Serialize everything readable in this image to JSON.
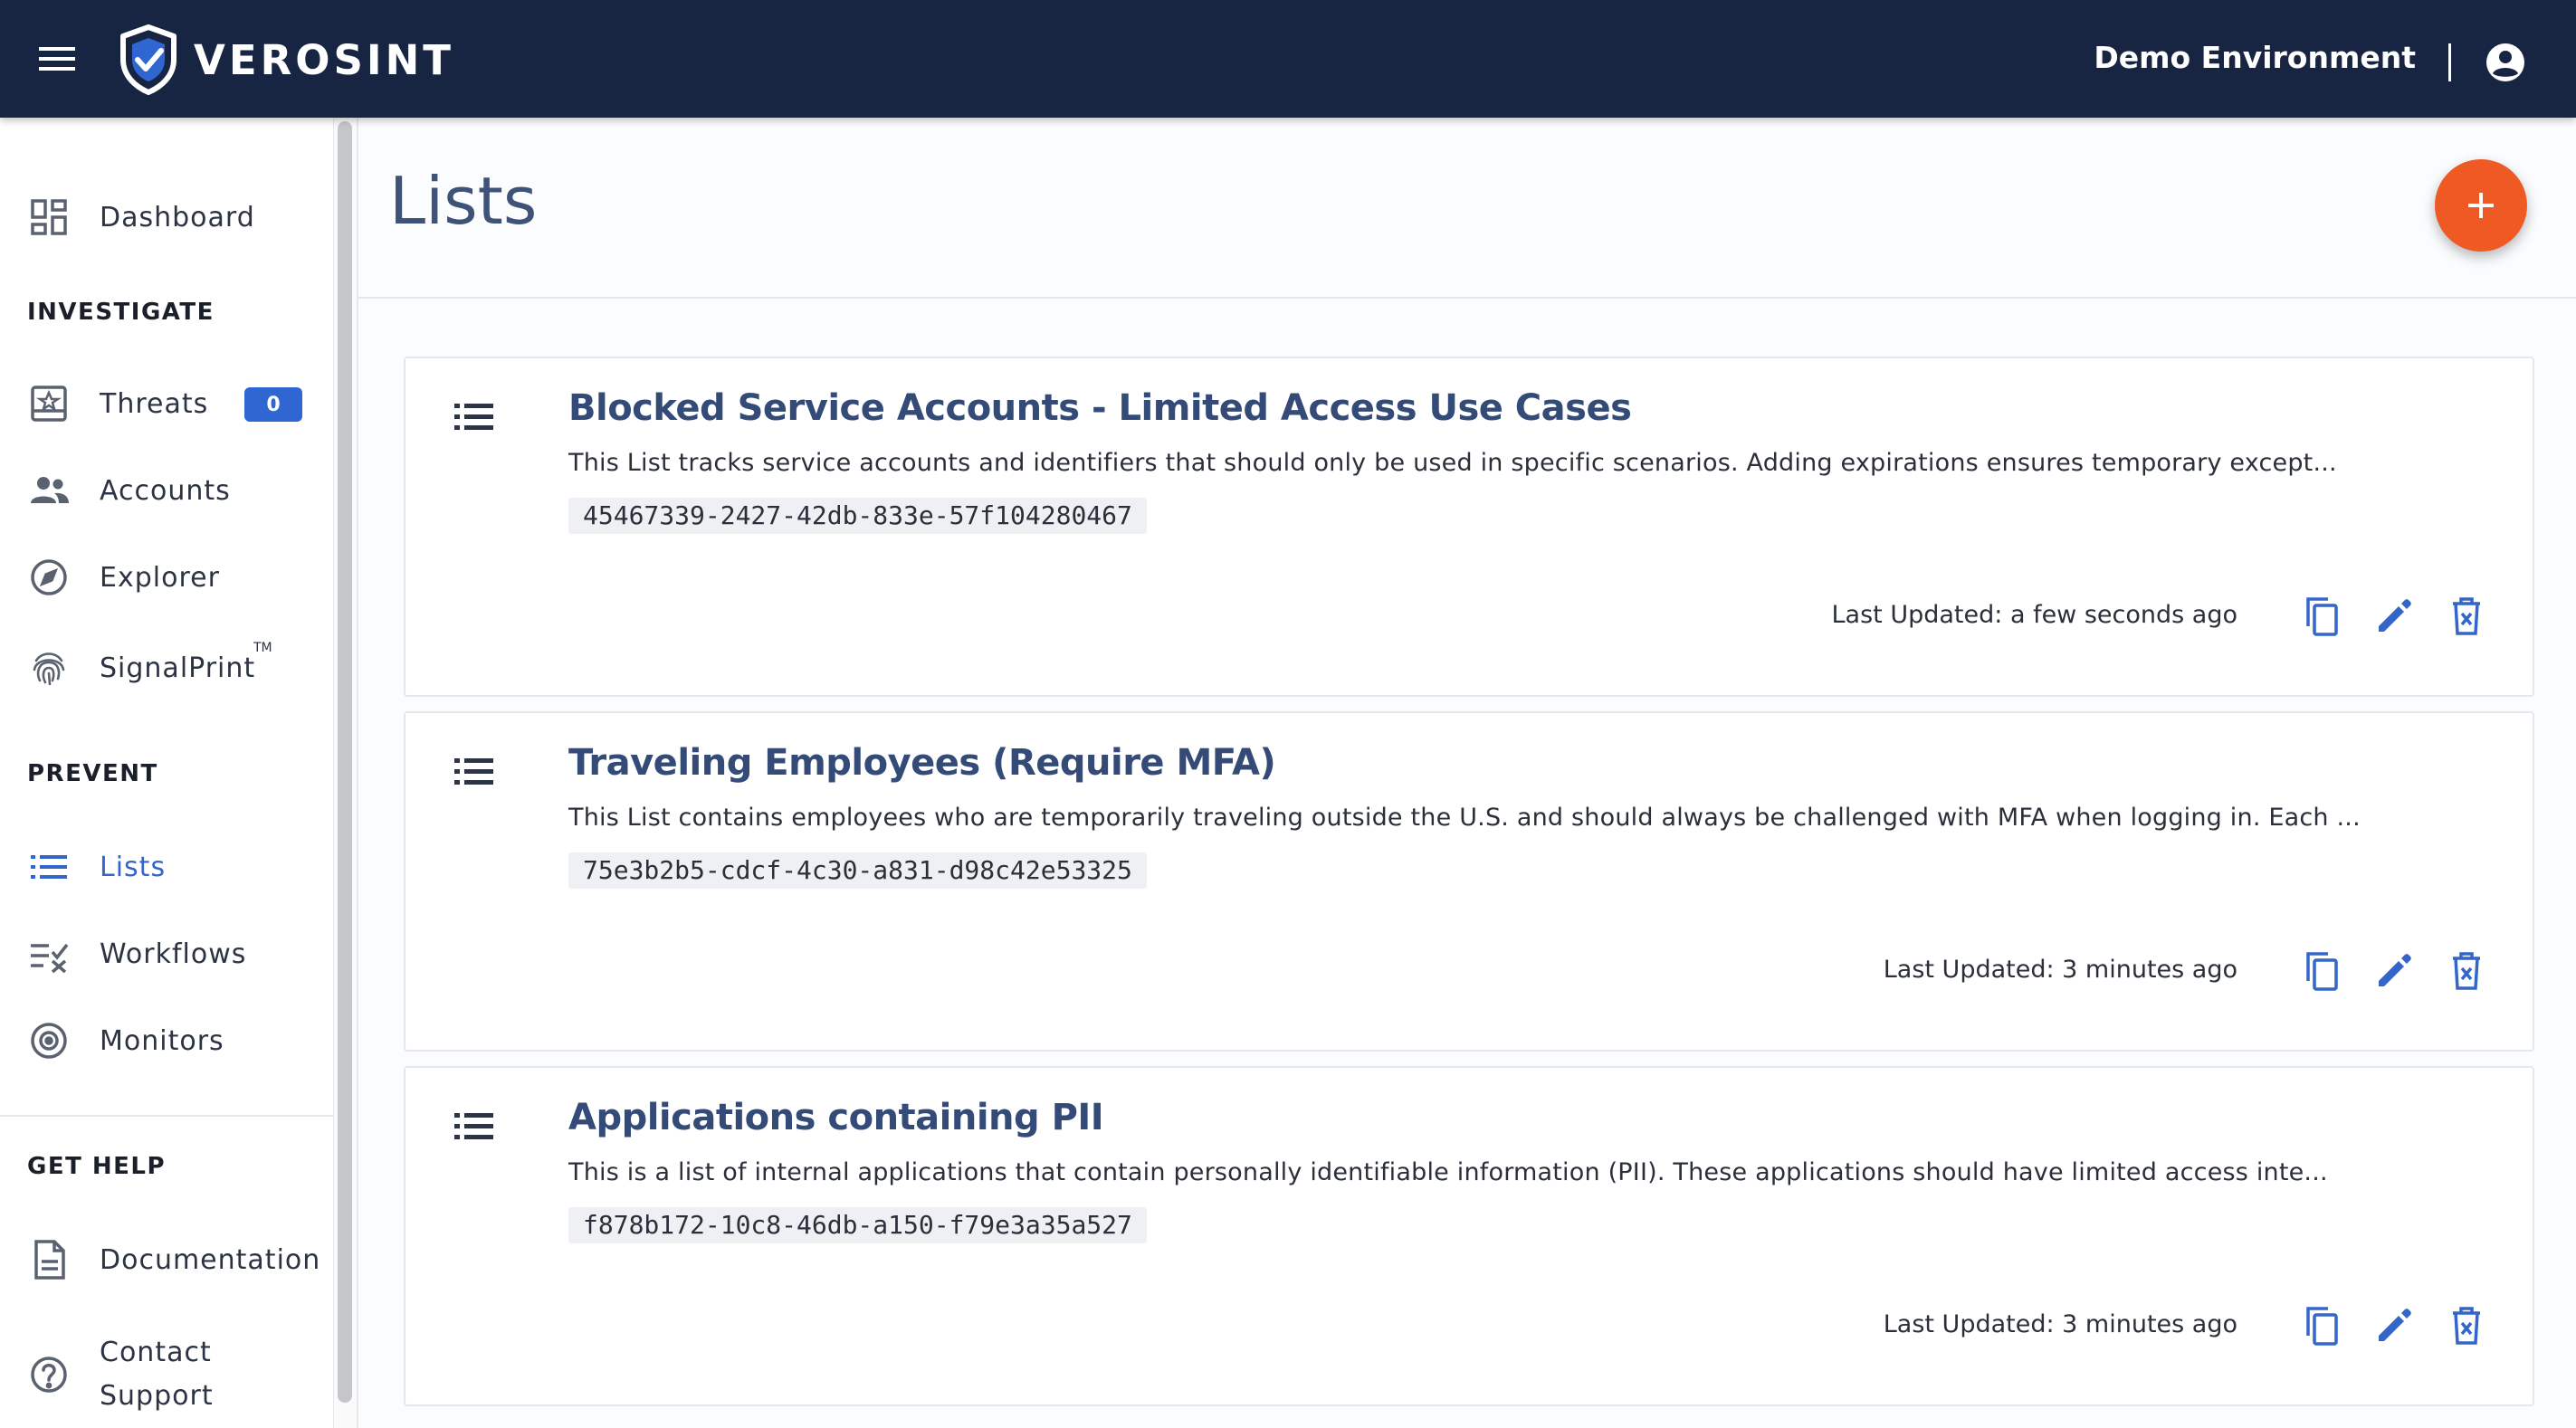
{
  "app": {
    "brand": "VEROSINT",
    "environment": "Demo Environment"
  },
  "colors": {
    "topbar": "#172442",
    "accent": "#3465c9",
    "fab": "#ef5a24",
    "title": "#344b78"
  },
  "icons": {
    "menu": "hamburger-icon",
    "logo": "shield-check-icon",
    "account": "account-circle-icon",
    "fab": "plus-icon",
    "list": "list-icon",
    "copy": "copy-icon",
    "edit": "pencil-icon",
    "delete": "trash-icon"
  },
  "sidebar": {
    "dashboard": {
      "label": "Dashboard",
      "icon": "dashboard-icon"
    },
    "investigate_heading": "INVESTIGATE",
    "threats": {
      "label": "Threats",
      "icon": "threats-icon",
      "badge": "0"
    },
    "accounts": {
      "label": "Accounts",
      "icon": "accounts-icon"
    },
    "explorer": {
      "label": "Explorer",
      "icon": "compass-icon"
    },
    "signalprint": {
      "label": "SignalPrint",
      "tm": "TM",
      "icon": "fingerprint-icon"
    },
    "prevent_heading": "PREVENT",
    "lists": {
      "label": "Lists",
      "icon": "list-icon",
      "active": true
    },
    "workflows": {
      "label": "Workflows",
      "icon": "workflows-icon"
    },
    "monitors": {
      "label": "Monitors",
      "icon": "monitor-target-icon"
    },
    "help_heading": "GET HELP",
    "documentation": {
      "label": "Documentation",
      "icon": "document-icon"
    },
    "contact": {
      "label_line1": "Contact",
      "label_line2": "Support",
      "icon": "help-circle-icon"
    }
  },
  "main": {
    "title": "Lists",
    "lists": [
      {
        "title": "Blocked Service Accounts - Limited Access Use Cases",
        "description": "This List tracks service accounts and identifiers that should only be used in specific scenarios. Adding expirations ensures temporary except...",
        "id": "45467339-2427-42db-833e-57f104280467",
        "updated": "Last Updated: a few seconds ago"
      },
      {
        "title": "Traveling Employees (Require MFA)",
        "description": "This List contains employees who are temporarily traveling outside the U.S. and should always be challenged with MFA when logging in. Each ...",
        "id": "75e3b2b5-cdcf-4c30-a831-d98c42e53325",
        "updated": "Last Updated: 3 minutes ago"
      },
      {
        "title": "Applications containing PII",
        "description": "This is a list of internal applications that contain personally identifiable information (PII). These applications should have limited access inte...",
        "id": "f878b172-10c8-46db-a150-f79e3a35a527",
        "updated": "Last Updated: 3 minutes ago"
      }
    ]
  }
}
